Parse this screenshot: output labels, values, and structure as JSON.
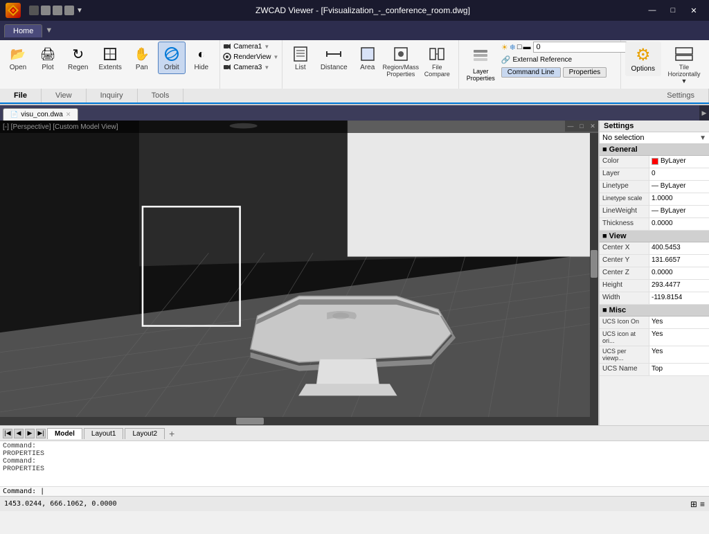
{
  "app": {
    "title": "ZWCAD Viewer - [Fvisualization_-_conference_room.dwg]",
    "logo_text": "ZW",
    "menu_tab": "Home",
    "menu_dropdown": "▼"
  },
  "titlebar": {
    "minimize": "—",
    "maximize": "□",
    "close": "✕",
    "title": "ZWCAD Viewer - [Fvisualization_-_conference_room.dwg]"
  },
  "ribbon": {
    "tabs": [
      "File",
      "View",
      "Inquiry",
      "Tools",
      "Settings"
    ],
    "active_tab": "File",
    "file_group": {
      "buttons": [
        {
          "id": "open",
          "label": "Open",
          "icon": "📂"
        },
        {
          "id": "plot",
          "label": "Plot",
          "icon": "🖨️"
        },
        {
          "id": "regen",
          "label": "Regen",
          "icon": "↺"
        },
        {
          "id": "extents",
          "label": "Extents",
          "icon": "⊕"
        },
        {
          "id": "pan",
          "label": "Pan",
          "icon": "✋"
        },
        {
          "id": "orbit",
          "label": "Orbit",
          "icon": "⊙"
        },
        {
          "id": "hide",
          "label": "Hide",
          "icon": "◐"
        }
      ]
    },
    "cameras": [
      "Camera1",
      "RenderView",
      "Camera3"
    ],
    "view_group": {
      "buttons": [
        {
          "id": "list",
          "label": "List",
          "icon": "≡"
        },
        {
          "id": "distance",
          "label": "Distance",
          "icon": "↔"
        },
        {
          "id": "area",
          "label": "Area",
          "icon": "□"
        },
        {
          "id": "region_mass",
          "label": "Region/Mass\nProperties",
          "icon": "⊞"
        },
        {
          "id": "file_compare",
          "label": "File\nCompare",
          "icon": "⊟"
        }
      ]
    },
    "layer_group": {
      "label": "Layer\nProperties",
      "cmd_line": "Command Line",
      "properties": "Properties",
      "ext_ref": "External Reference",
      "layer_dropdown": "0",
      "layer_icons": [
        "☀",
        "❄",
        "□",
        "▬"
      ]
    },
    "tools_group": {
      "options_label": "Options",
      "tile_label": "Tile\nHorizontally ▼"
    }
  },
  "viewport": {
    "window_controls": [
      "—",
      "□",
      "✕"
    ],
    "scroll_indicator": "▶"
  },
  "properties": {
    "header": "Settings",
    "selection": "No selection",
    "sections": [
      {
        "name": "General",
        "rows": [
          {
            "key": "Color",
            "value": "ByLayer",
            "has_swatch": true
          },
          {
            "key": "Layer",
            "value": "0"
          },
          {
            "key": "Linetype",
            "value": "— ByLayer"
          },
          {
            "key": "Linetype scale",
            "value": "1.0000"
          },
          {
            "key": "LineWeight",
            "value": "— ByLayer"
          },
          {
            "key": "Thickness",
            "value": "0.0000"
          }
        ]
      },
      {
        "name": "View",
        "rows": [
          {
            "key": "Center X",
            "value": "400.5453"
          },
          {
            "key": "Center Y",
            "value": "131.6657"
          },
          {
            "key": "Center Z",
            "value": "0.0000"
          },
          {
            "key": "Height",
            "value": "293.4477"
          },
          {
            "key": "Width",
            "value": "-119.8154"
          }
        ]
      },
      {
        "name": "Misc",
        "rows": [
          {
            "key": "UCS Icon On",
            "value": "Yes"
          },
          {
            "key": "UCS icon at ori...",
            "value": "Yes"
          },
          {
            "key": "UCS per viewp...",
            "value": "Yes"
          },
          {
            "key": "UCS Name",
            "value": "Top"
          }
        ]
      }
    ]
  },
  "command_window": {
    "lines": [
      "Command:",
      "PROPERTIES",
      "Command:",
      "PROPERTIES"
    ],
    "prompt": "Command: |"
  },
  "status_bar": {
    "coords": "1453.0244, 666.1062, 0.0000",
    "icons": [
      "⊞",
      "≡"
    ]
  },
  "sheet_tabs": {
    "tabs": [
      "Model",
      "Layout1",
      "Layout2"
    ],
    "active": "Model"
  },
  "doc_tabs": {
    "tabs": [
      {
        "label": "visu_con.dwa",
        "active": true
      }
    ]
  }
}
